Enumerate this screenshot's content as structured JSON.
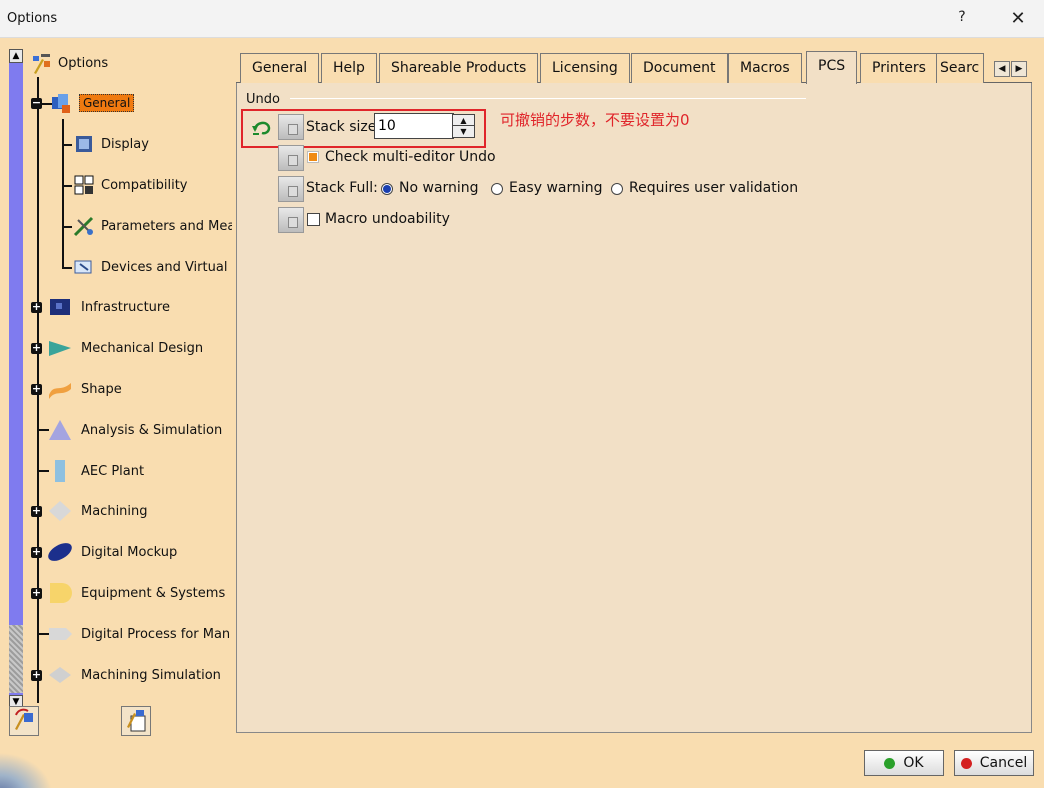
{
  "window": {
    "title": "Options",
    "help_label": "?",
    "close_label": "✕"
  },
  "tree": {
    "root": "Options",
    "items": [
      {
        "label": "General",
        "icon": "general-icon",
        "selected": true
      },
      {
        "label": "Display",
        "icon": "display-icon"
      },
      {
        "label": "Compatibility",
        "icon": "compatibility-icon"
      },
      {
        "label": "Parameters and Meas",
        "icon": "parameters-icon"
      },
      {
        "label": "Devices and Virtual R",
        "icon": "devices-icon"
      },
      {
        "label": "Infrastructure",
        "icon": "infrastructure-icon"
      },
      {
        "label": "Mechanical Design",
        "icon": "mechanical-design-icon"
      },
      {
        "label": "Shape",
        "icon": "shape-icon"
      },
      {
        "label": "Analysis & Simulation",
        "icon": "analysis-icon"
      },
      {
        "label": "AEC Plant",
        "icon": "aec-plant-icon"
      },
      {
        "label": "Machining",
        "icon": "machining-icon"
      },
      {
        "label": "Digital Mockup",
        "icon": "digital-mockup-icon"
      },
      {
        "label": "Equipment & Systems",
        "icon": "equipment-icon"
      },
      {
        "label": "Digital Process for Manu",
        "icon": "digital-process-icon"
      },
      {
        "label": "Machining Simulation",
        "icon": "machining-simulation-icon"
      }
    ]
  },
  "tabs": [
    "General",
    "Help",
    "Shareable Products",
    "Licensing",
    "Document",
    "Macros",
    "PCS",
    "Printers",
    "Searc"
  ],
  "active_tab": "PCS",
  "undo": {
    "section": "Undo",
    "stack_size_label": "Stack size",
    "stack_size_value": "10",
    "annotation": "可撤销的步数，不要设置为0",
    "multi_editor_label": "Check multi-editor Undo",
    "stack_full_label": "Stack Full:",
    "options": [
      "No warning",
      "Easy warning",
      "Requires user validation"
    ],
    "selected_option": "No warning",
    "macro_label": "Macro undoability"
  },
  "buttons": {
    "ok": "OK",
    "cancel": "Cancel"
  },
  "colors": {
    "background": "#f9ddb0",
    "selection": "#f07a10",
    "annotation": "#e0252a",
    "scrollbar": "#7f7bef",
    "ok_dot": "#2aa02a",
    "cancel_dot": "#d42020"
  }
}
